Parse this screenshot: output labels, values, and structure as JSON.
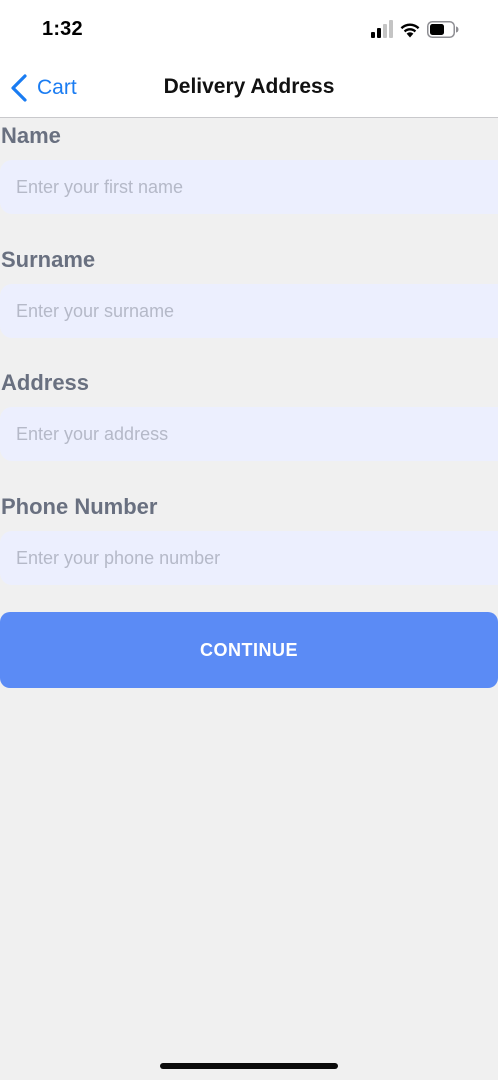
{
  "status_bar": {
    "time": "1:32",
    "icons": [
      "cellular-signal-icon",
      "wifi-icon",
      "battery-icon"
    ]
  },
  "nav": {
    "back_label": "Cart",
    "back_icon": "chevron-left-icon",
    "title": "Delivery Address"
  },
  "form": {
    "fields": [
      {
        "label": "Name",
        "placeholder": "Enter your first name",
        "value": ""
      },
      {
        "label": "Surname",
        "placeholder": "Enter your surname",
        "value": ""
      },
      {
        "label": "Address",
        "placeholder": "Enter your address",
        "value": ""
      },
      {
        "label": "Phone Number",
        "placeholder": "Enter your phone number",
        "value": ""
      }
    ],
    "submit_label": "CONTINUE"
  },
  "colors": {
    "accent": "#1a7cf2",
    "button": "#5b8bf5",
    "input_bg": "#eceffe",
    "label": "#697080",
    "background": "#f0f0f0"
  }
}
